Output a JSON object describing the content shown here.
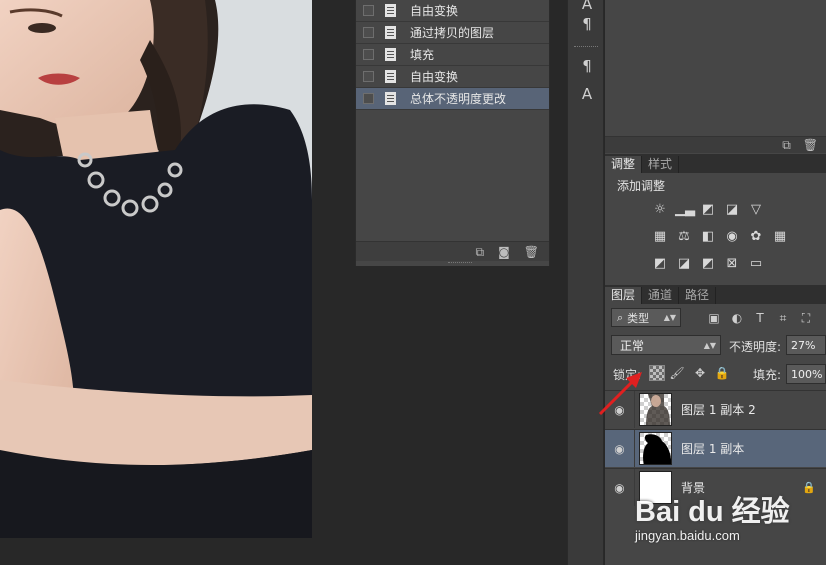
{
  "history": {
    "items": [
      {
        "label": "自由变换",
        "selected": false
      },
      {
        "label": "通过拷贝的图层",
        "selected": false
      },
      {
        "label": "填充",
        "selected": false
      },
      {
        "label": "自由变换",
        "selected": false
      },
      {
        "label": "总体不透明度更改",
        "selected": true
      }
    ]
  },
  "adjustments": {
    "tabs": [
      "调整",
      "样式"
    ],
    "title": "添加调整"
  },
  "layers": {
    "tabs": [
      "图层",
      "通道",
      "路径"
    ],
    "kind_filter": "类型",
    "blend_mode": "正常",
    "opacity_label": "不透明度:",
    "opacity_value": "27%",
    "lock_label": "锁定:",
    "fill_label": "填充:",
    "fill_value": "100%",
    "rows": [
      {
        "name": "图层 1 副本 2",
        "selected": false
      },
      {
        "name": "图层 1 副本",
        "selected": true
      },
      {
        "name": "背景",
        "selected": false
      }
    ]
  },
  "watermark": {
    "brand": "Bai du 经验",
    "url": "jingyan.baidu.com"
  },
  "colors": {
    "panel_bg": "#464646",
    "selection": "#58667a",
    "annotation_arrow": "#e02020"
  }
}
